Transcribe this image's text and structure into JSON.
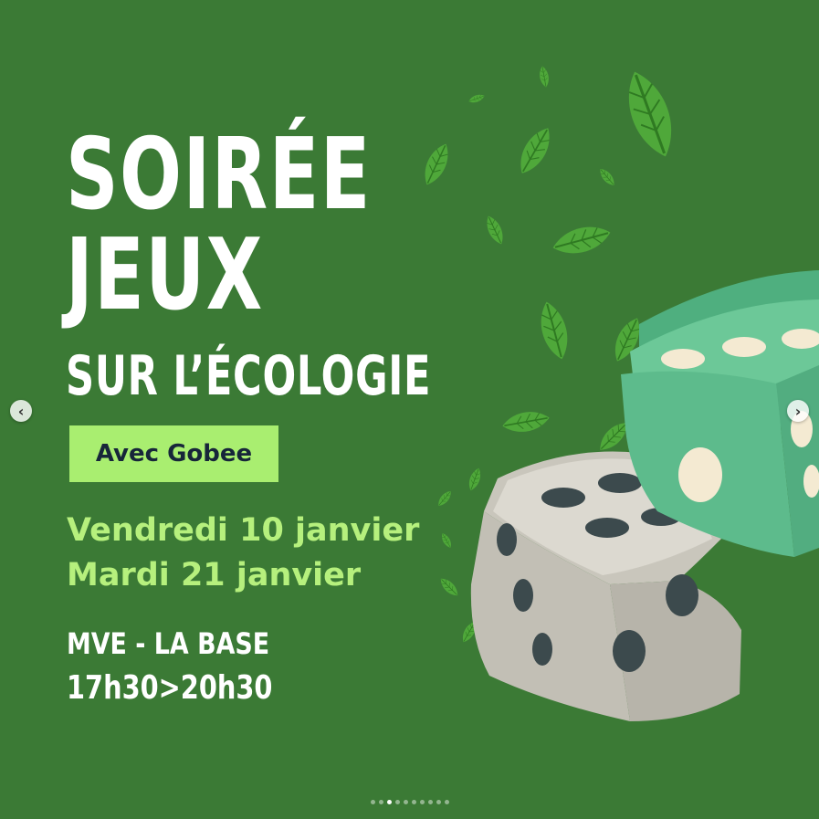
{
  "poster": {
    "title_line1": "SOIRÉE",
    "title_line2": "JEUX",
    "subtitle": "SUR L’ÉCOLOGIE",
    "badge": "Avec Gobee",
    "dates": [
      "Vendredi 10 janvier",
      "Mardi 21 janvier"
    ],
    "venue": "MVE - LA BASE",
    "hours": "17h30>20h30"
  },
  "illustration": {
    "dice": [
      "grey-die-icon",
      "green-die-icon"
    ],
    "leaves": "leaf-icon"
  },
  "carousel": {
    "prev_icon": "chevron-left-icon",
    "next_icon": "chevron-right-icon",
    "prev_glyph": "‹",
    "next_glyph": "›",
    "slide_count": 10,
    "active_index": 2
  },
  "colors": {
    "background": "#3b7a35",
    "title": "#ffffff",
    "badge_bg": "#a9ee70",
    "badge_text": "#17263a",
    "dates": "#b6f07d",
    "grey_die": "#d7d4cb",
    "green_die": "#5dbb8c",
    "pip_dark": "#3c4a4d",
    "pip_light": "#f4ead2"
  }
}
